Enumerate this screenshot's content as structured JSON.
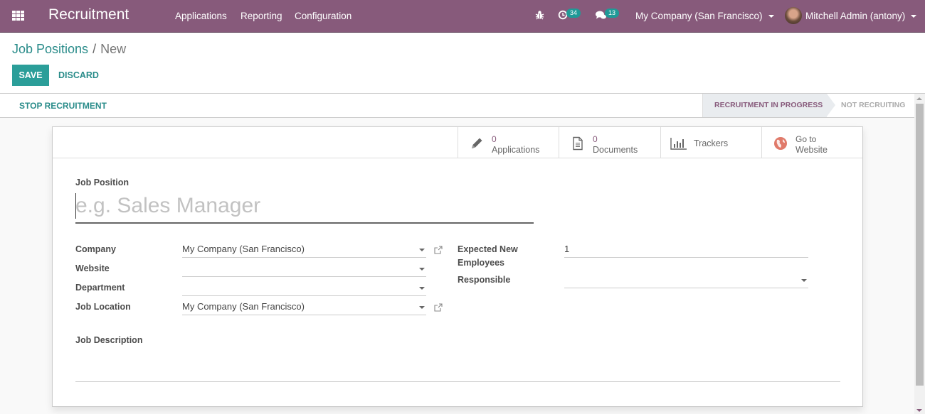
{
  "navbar": {
    "app_title": "Recruitment",
    "menus": [
      "Applications",
      "Reporting",
      "Configuration"
    ],
    "activity_count": "34",
    "message_count": "13",
    "company": "My Company (San Francisco)",
    "user": "Mitchell Admin (antony)",
    "icons": {
      "apps": "grid-icon",
      "debug": "bug-icon",
      "activity": "clock-icon",
      "messages": "chat-icon"
    }
  },
  "control_panel": {
    "breadcrumb": {
      "parent": "Job Positions",
      "separator": "/",
      "current": "New"
    },
    "save_label": "SAVE",
    "discard_label": "DISCARD"
  },
  "statusbar": {
    "action_label": "STOP RECRUITMENT",
    "stages": [
      {
        "label": "RECRUITMENT IN PROGRESS",
        "active": true
      },
      {
        "label": "NOT RECRUITING",
        "active": false
      }
    ]
  },
  "smart_buttons": [
    {
      "count": "0",
      "label": "Applications",
      "icon": "pencil-icon"
    },
    {
      "count": "0",
      "label": "Documents",
      "icon": "document-icon"
    },
    {
      "label": "Trackers",
      "icon": "bar-chart-icon"
    },
    {
      "label_line1": "Go to",
      "label_line2": "Website",
      "icon": "globe-icon"
    }
  ],
  "form": {
    "job_position_label": "Job Position",
    "job_position_placeholder": "e.g. Sales Manager",
    "job_position_value": "",
    "left_fields": [
      {
        "label": "Company",
        "value": "My Company (San Francisco)",
        "has_link": true
      },
      {
        "label": "Website",
        "value": "",
        "has_link": false
      },
      {
        "label": "Department",
        "value": "",
        "has_link": false
      },
      {
        "label": "Job Location",
        "value": "My Company (San Francisco)",
        "has_link": true
      }
    ],
    "right_fields": [
      {
        "label_line1": "Expected New",
        "label_line2": "Employees",
        "value": "1"
      },
      {
        "label": "Responsible",
        "value": ""
      }
    ],
    "job_description_label": "Job Description",
    "job_description_value": ""
  },
  "colors": {
    "brand": "#875a7b",
    "primary": "#2b9e99",
    "badge": "#1f9a97",
    "globe": "#e07a6a"
  }
}
